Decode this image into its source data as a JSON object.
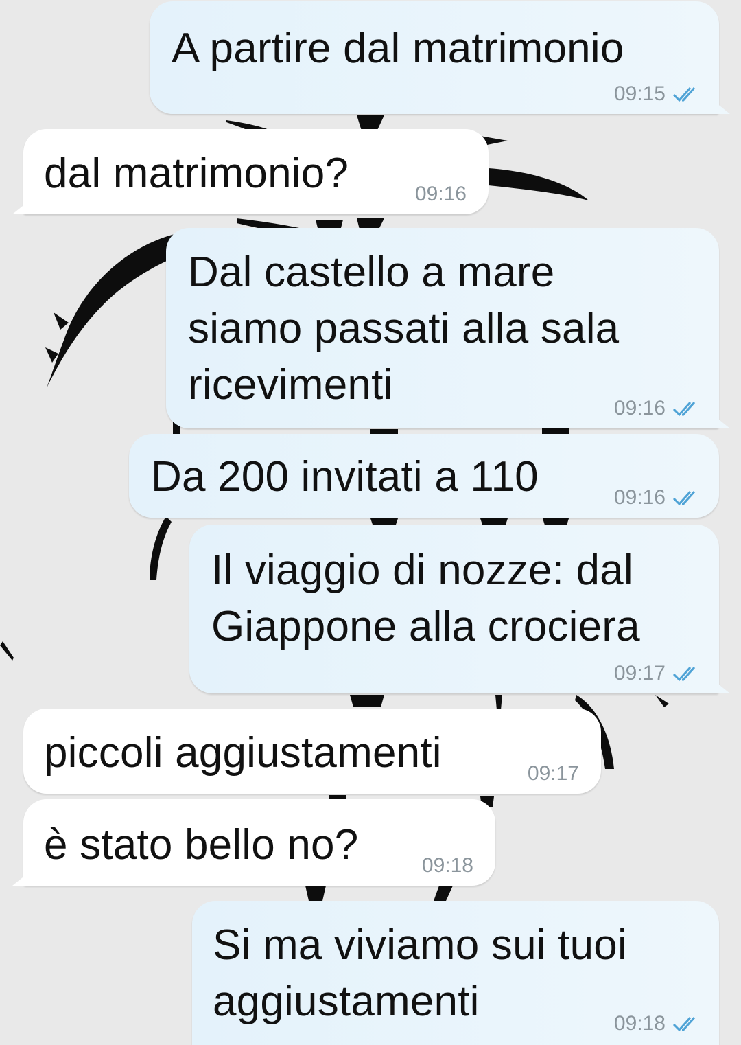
{
  "colors": {
    "background": "#e9e9e9",
    "outgoing_bubble": "#e9f5fb",
    "incoming_bubble": "#ffffff",
    "timestamp": "#8b959c",
    "read_tick": "#4fa3d6"
  },
  "messages": [
    {
      "direction": "outgoing",
      "lines": [
        "A partire dal matrimonio"
      ],
      "time": "09:15",
      "status_icon": "double-tick-read-icon"
    },
    {
      "direction": "incoming",
      "lines": [
        "dal matrimonio?"
      ],
      "time": "09:16"
    },
    {
      "direction": "outgoing",
      "lines": [
        "Dal castello a mare",
        "siamo passati alla sala",
        "ricevimenti"
      ],
      "time": "09:16",
      "status_icon": "double-tick-read-icon"
    },
    {
      "direction": "outgoing",
      "lines": [
        "Da 200 invitati a 110"
      ],
      "time": "09:16",
      "status_icon": "double-tick-read-icon"
    },
    {
      "direction": "outgoing",
      "lines": [
        "Il viaggio di nozze: dal",
        "Giappone alla crociera"
      ],
      "time": "09:17",
      "status_icon": "double-tick-read-icon"
    },
    {
      "direction": "incoming",
      "lines": [
        "piccoli aggiustamenti"
      ],
      "time": "09:17"
    },
    {
      "direction": "incoming",
      "lines": [
        "è stato bello no?"
      ],
      "time": "09:18"
    },
    {
      "direction": "outgoing",
      "lines": [
        "Si ma viviamo sui tuoi",
        "aggiustamenti"
      ],
      "time": "09:18",
      "status_icon": "double-tick-read-icon"
    }
  ]
}
